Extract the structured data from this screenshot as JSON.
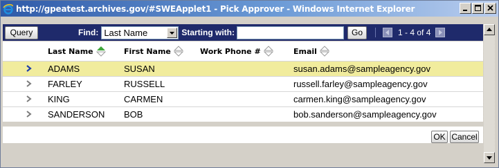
{
  "window": {
    "title": "http://gpeatest.archives.gov/#SWEApplet1 - Pick Approver - Windows Internet Explorer"
  },
  "toolbar": {
    "query_label": "Query",
    "find_label": "Find:",
    "find_selected": "Last Name",
    "starting_with_label": "Starting with:",
    "starting_with_value": "",
    "go_label": "Go",
    "record_count": "1 - 4 of 4"
  },
  "grid": {
    "columns": [
      "Last Name",
      "First Name",
      "Work Phone #",
      "Email"
    ],
    "sort_column": "Last Name",
    "selected_row": 0,
    "rows": [
      {
        "last": "ADAMS",
        "first": "SUSAN",
        "phone": "",
        "email": "susan.adams@sampleagency.gov"
      },
      {
        "last": "FARLEY",
        "first": "RUSSELL",
        "phone": "",
        "email": "russell.farley@sampleagency.gov"
      },
      {
        "last": "KING",
        "first": "CARMEN",
        "phone": "",
        "email": "carmen.king@sampleagency.gov"
      },
      {
        "last": "SANDERSON",
        "first": "BOB",
        "phone": "",
        "email": "bob.sanderson@sampleagency.gov"
      }
    ]
  },
  "footer": {
    "ok_label": "OK",
    "cancel_label": "Cancel"
  },
  "colors": {
    "toolbar_bg": "#1f2a6b",
    "selected_row_bg": "#f1ec9d",
    "sort_active": "#3fa63a",
    "chevron_active": "#1f3ea8"
  }
}
